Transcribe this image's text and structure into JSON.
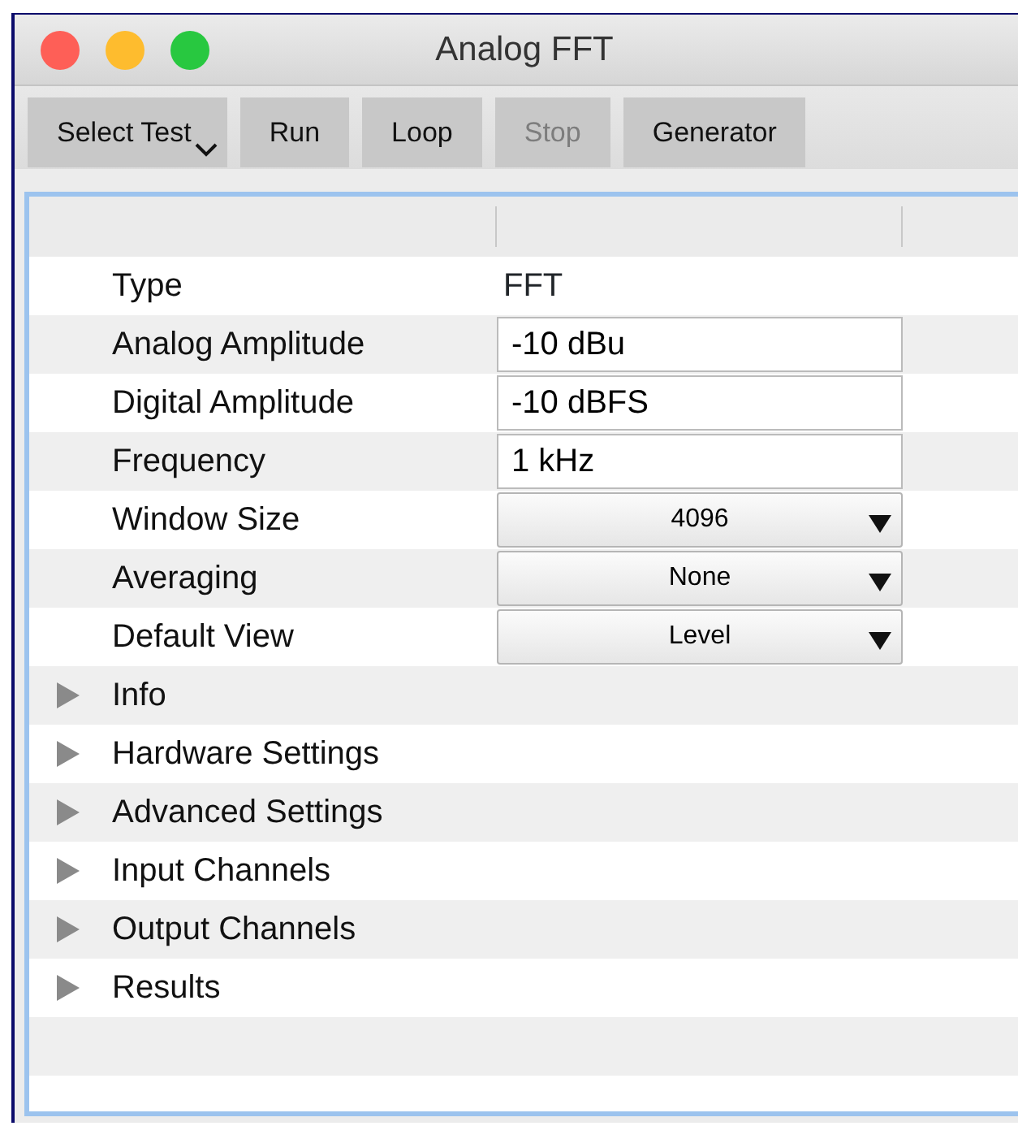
{
  "window": {
    "title": "Analog FFT"
  },
  "toolbar": [
    {
      "label": "Select Test",
      "kind": "menu",
      "disabled": false
    },
    {
      "label": "Run",
      "kind": "button",
      "disabled": false
    },
    {
      "label": "Loop",
      "kind": "button",
      "disabled": false
    },
    {
      "label": "Stop",
      "kind": "button",
      "disabled": true
    },
    {
      "label": "Generator",
      "kind": "button",
      "disabled": false
    }
  ],
  "properties": [
    {
      "label": "Type",
      "kind": "text",
      "value": "FFT"
    },
    {
      "label": "Analog Amplitude",
      "kind": "field",
      "value": "-10 dBu"
    },
    {
      "label": "Digital Amplitude",
      "kind": "field",
      "value": "-10 dBFS"
    },
    {
      "label": "Frequency",
      "kind": "field",
      "value": "1 kHz"
    },
    {
      "label": "Window Size",
      "kind": "dropdown",
      "value": "4096"
    },
    {
      "label": "Averaging",
      "kind": "dropdown",
      "value": "None"
    },
    {
      "label": "Default View",
      "kind": "dropdown",
      "value": "Level"
    }
  ],
  "groups": [
    {
      "label": "Info",
      "expanded": false
    },
    {
      "label": "Hardware Settings",
      "expanded": false
    },
    {
      "label": "Advanced Settings",
      "expanded": false
    },
    {
      "label": "Input Channels",
      "expanded": false
    },
    {
      "label": "Output Channels",
      "expanded": false
    },
    {
      "label": "Results",
      "expanded": false
    }
  ]
}
